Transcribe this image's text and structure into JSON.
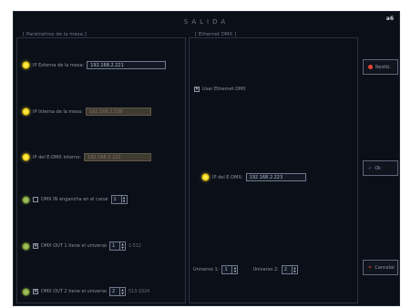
{
  "window": {
    "title": "SALIDA",
    "corner_label": "a6"
  },
  "left_panel": {
    "label": "[ Parámetros de la mesa ]",
    "external_ip_label": "IP Externa de la mesa:",
    "external_ip_value": "192.168.2.221",
    "internal_ip_label": "IP Interna de la mesa:",
    "internal_ip_value": "192.168.2.338",
    "edmx_internal_label": "IP del E-DMX interno:",
    "edmx_internal_value": "192.168.2.222",
    "dmxin_label": "DMX IN engancha en el canal",
    "dmxin_channel": "1",
    "out1_label": "DMX OUT 1 tiene el universo",
    "out1_universe": "1",
    "out1_range": "1-512",
    "out2_label": "DMX OUT 2 tiene el universo",
    "out2_universe": "2",
    "out2_range": "513-1024"
  },
  "right_panel": {
    "label": "[ Ethernet DMX ]",
    "use_ethernet_label": "Usar Ethernet DMX",
    "edmx_ip_label": "IP del E-DMX:",
    "edmx_ip_value": "192.168.2.223",
    "universe1_label": "Universo 1:",
    "universe1_value": "1",
    "universe2_label": "Universo 2:",
    "universe2_value": "2"
  },
  "buttons": {
    "reset": "Restbl.",
    "ok": "Ok",
    "cancel": "Cancelar"
  },
  "colors": {
    "background": "#0b0f17",
    "bulb": "#ffd800",
    "reset_dot": "#e44837"
  }
}
